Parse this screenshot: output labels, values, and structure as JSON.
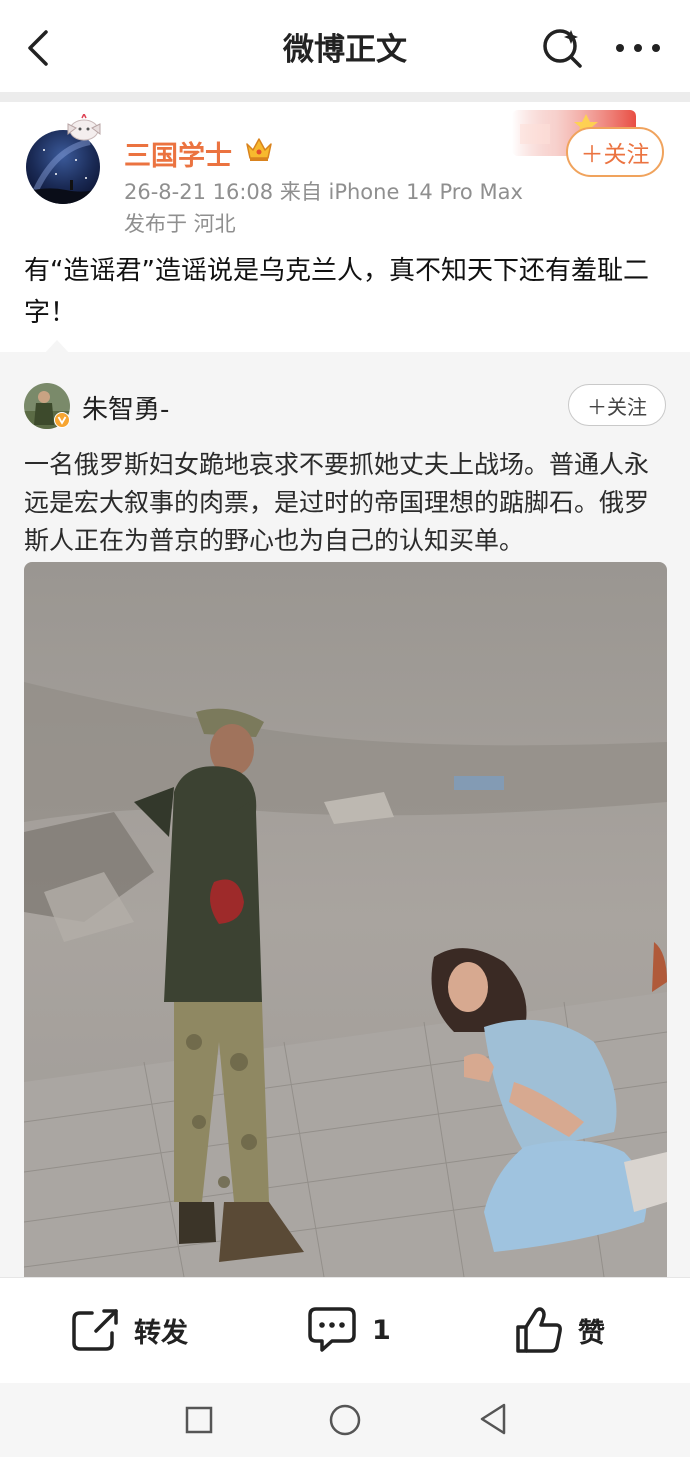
{
  "nav": {
    "title": "微博正文",
    "icons": [
      "back-icon",
      "search-icon",
      "more-icon"
    ]
  },
  "post": {
    "author": "三国学士",
    "follow_label": "＋关注",
    "meta_line": "26-8-21 16:08  来自 iPhone 14 Pro Max",
    "location": "发布于 河北",
    "text": "有“造谣君”造谣说是乌克兰人，真不知天下还有羞耻二字！"
  },
  "repost": {
    "author": "朱智勇-",
    "follow_label": "＋关注",
    "text": "一名俄罗斯妇女跪地哀求不要抓她丈夫上战场。普通人永远是宏大叙事的肉票，是过时的帝国理想的踮脚石。俄罗斯人正在为普京的野心也为自己的认知买单。"
  },
  "actions": {
    "repost_label": "转发",
    "comment_count": "1",
    "like_label": "赞"
  },
  "colors": {
    "author_orange": "#eb7340",
    "follow_border": "#f0a35d",
    "meta_gray": "#8f8f8f",
    "repost_bg": "#f5f5f5"
  }
}
